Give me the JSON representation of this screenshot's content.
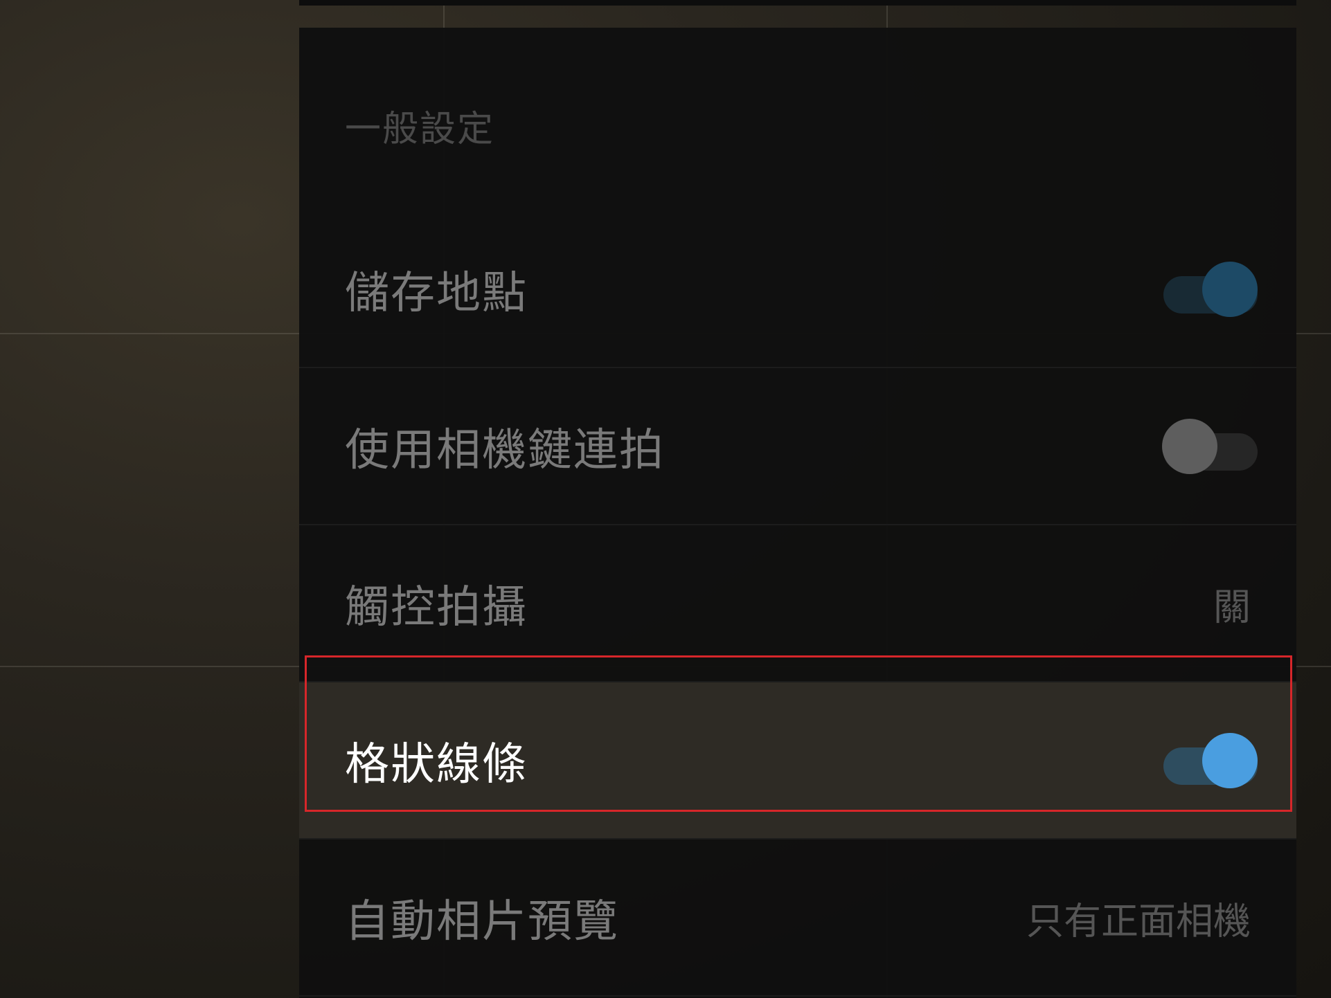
{
  "settings": {
    "section_header": "一般設定",
    "rows": [
      {
        "label": "儲存地點",
        "control": "toggle",
        "state": "on",
        "highlighted": false
      },
      {
        "label": "使用相機鍵連拍",
        "control": "toggle",
        "state": "off",
        "highlighted": false
      },
      {
        "label": "觸控拍攝",
        "control": "value",
        "value": "關",
        "highlighted": false
      },
      {
        "label": "格狀線條",
        "control": "toggle",
        "state": "on",
        "highlighted": true
      },
      {
        "label": "自動相片預覽",
        "control": "value",
        "value": "只有正面相機",
        "highlighted": false
      }
    ]
  },
  "colors": {
    "accent": "#4a9ee0",
    "highlight_border": "#d6262a",
    "panel_background": "#101010"
  }
}
